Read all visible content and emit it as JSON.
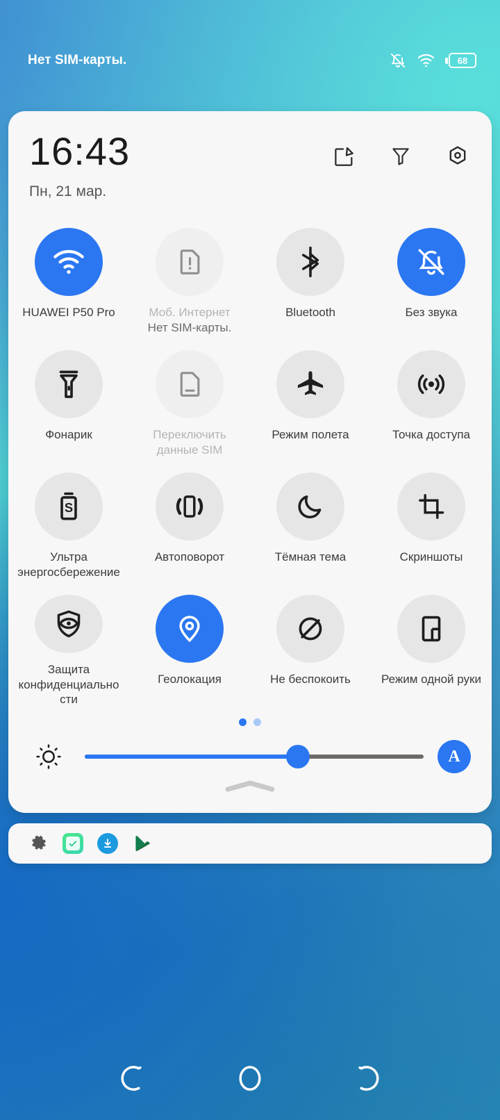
{
  "statusbar": {
    "carrier": "Нет SIM-карты.",
    "notif_off_icon": "bell-off-icon",
    "wifi_icon": "wifi-icon",
    "battery_level": "68"
  },
  "panel": {
    "time": "16:43",
    "date": "Пн, 21 мар.",
    "header_icons": [
      {
        "name": "edit-icon",
        "label": "Изменить"
      },
      {
        "name": "filter-icon",
        "label": "Фильтр"
      },
      {
        "name": "settings-icon",
        "label": "Настройки"
      }
    ],
    "accent_color": "#2b77f2",
    "inactive_color": "#e6e6e6"
  },
  "tiles": [
    {
      "icon": "wifi-icon",
      "label": "HUAWEI P50 Pro",
      "sub": "",
      "state": "on"
    },
    {
      "icon": "sim-alert-icon",
      "label": "Моб. Интернет",
      "sub": "Нет SIM-карты.",
      "state": "disabled"
    },
    {
      "icon": "bluetooth-icon",
      "label": "Bluetooth",
      "sub": "",
      "state": "off"
    },
    {
      "icon": "bell-off-icon",
      "label": "Без звука",
      "sub": "",
      "state": "on"
    },
    {
      "icon": "flashlight-icon",
      "label": "Фонарик",
      "sub": "",
      "state": "off"
    },
    {
      "icon": "sim-card-icon",
      "label": "Переключить данные SIM",
      "sub": "",
      "state": "disabled"
    },
    {
      "icon": "airplane-icon",
      "label": "Режим полета",
      "sub": "",
      "state": "off"
    },
    {
      "icon": "hotspot-icon",
      "label": "Точка доступа",
      "sub": "",
      "state": "off"
    },
    {
      "icon": "battery-saver-icon",
      "label": "Ультра энергосбережение",
      "sub": "",
      "state": "off"
    },
    {
      "icon": "auto-rotate-icon",
      "label": "Автоповорот",
      "sub": "",
      "state": "off"
    },
    {
      "icon": "moon-icon",
      "label": "Тёмная тема",
      "sub": "",
      "state": "off"
    },
    {
      "icon": "crop-icon",
      "label": "Скриншоты",
      "sub": "",
      "state": "off"
    },
    {
      "icon": "shield-eye-icon",
      "label": "Защита конфиденциальности",
      "sub": "",
      "state": "off"
    },
    {
      "icon": "location-pin-icon",
      "label": "Геолокация",
      "sub": "",
      "state": "on"
    },
    {
      "icon": "dnd-icon",
      "label": "Не беспокоить",
      "sub": "",
      "state": "off"
    },
    {
      "icon": "one-hand-icon",
      "label": "Режим одной руки",
      "sub": "",
      "state": "off"
    }
  ],
  "brightness": {
    "sun_icon": "brightness-icon",
    "value_percent": 63,
    "auto_label": "A",
    "pages": 2,
    "active_page": 1
  },
  "tray": {
    "icons": [
      {
        "name": "gear-icon"
      },
      {
        "name": "checkmark-app-icon"
      },
      {
        "name": "download-icon"
      },
      {
        "name": "play-store-icon"
      }
    ]
  },
  "navbar": {
    "back_label": "Назад",
    "home_label": "Главный экран",
    "recents_label": "Последние приложения"
  }
}
